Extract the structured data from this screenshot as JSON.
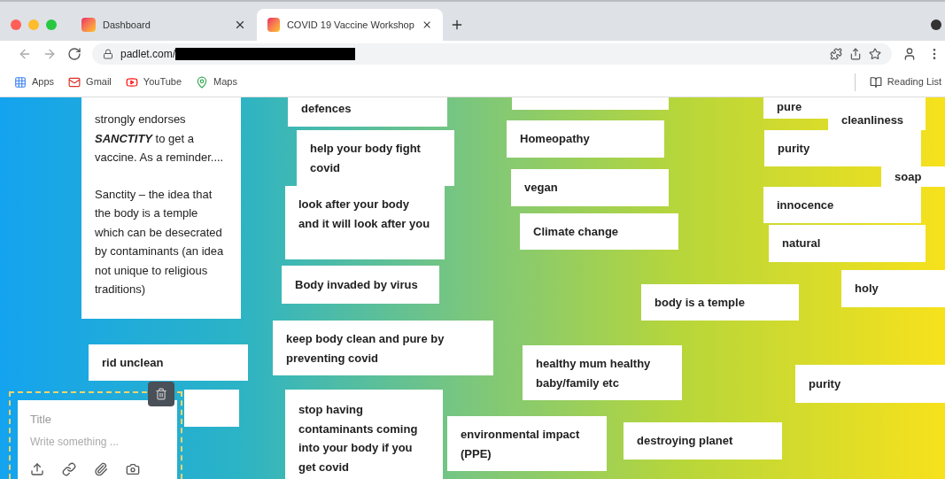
{
  "browser": {
    "tabs": [
      {
        "title": "Dashboard",
        "selected": false
      },
      {
        "title": "COVID 19 Vaccine Workshop",
        "selected": true
      }
    ],
    "url": "padlet.com/",
    "bookmarks": [
      "Apps",
      "Gmail",
      "YouTube",
      "Maps"
    ],
    "reading_list": "Reading List"
  },
  "cards": [
    {
      "paragraphs": [
        "strongly endorses **SANCTITY** to get a vaccine. As a reminder....",
        "Sanctity – the idea that the body is a temple which can be desecrated by contaminants (an idea not unique to religious traditions)"
      ]
    },
    {
      "paragraphs": [
        "defences"
      ]
    },
    {
      "paragraphs": [
        "pure"
      ]
    },
    {
      "paragraphs": [
        "cleanliness"
      ]
    },
    {
      "paragraphs": [
        "Homeopathy"
      ]
    },
    {
      "paragraphs": [
        "help your body fight covid"
      ]
    },
    {
      "paragraphs": [
        "purity"
      ]
    },
    {
      "paragraphs": [
        "soap"
      ]
    },
    {
      "paragraphs": [
        "vegan"
      ]
    },
    {
      "paragraphs": [
        "look after your body and it will look after you"
      ]
    },
    {
      "paragraphs": [
        "innocence"
      ]
    },
    {
      "paragraphs": [
        "Climate change"
      ]
    },
    {
      "paragraphs": [
        "natural"
      ]
    },
    {
      "paragraphs": [
        "Body invaded by virus"
      ]
    },
    {
      "paragraphs": [
        "holy"
      ]
    },
    {
      "paragraphs": [
        "body is a temple"
      ]
    },
    {
      "paragraphs": [
        "rid unclean"
      ]
    },
    {
      "paragraphs": [
        "keep body clean and pure by preventing covid"
      ]
    },
    {
      "paragraphs": [
        "healthy mum healthy baby/family etc"
      ]
    },
    {
      "paragraphs": [
        "purity"
      ]
    },
    {
      "paragraphs": [
        "stop having contaminants coming into your body if you get covid"
      ]
    },
    {
      "paragraphs": [
        "environmental impact (PPE)"
      ]
    },
    {
      "paragraphs": [
        "destroying planet"
      ]
    }
  ],
  "composer": {
    "title_placeholder": "Title",
    "body_placeholder": "Write something ..."
  }
}
